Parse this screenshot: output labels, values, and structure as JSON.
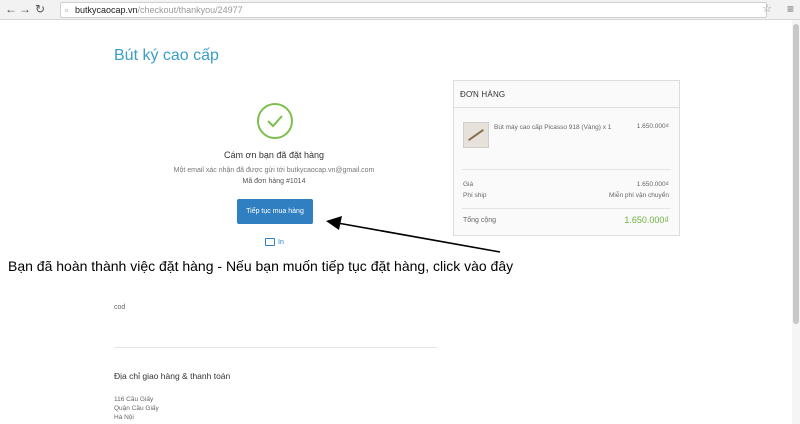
{
  "browser": {
    "url_host": "butkycaocap.vn",
    "url_path": "/checkout/thankyou/24977"
  },
  "page": {
    "shop_title": "Bút ký cao cấp",
    "thanks": "Cám ơn bạn đã đặt hàng",
    "email_notice": "Một email xác nhận đã được gửi tới butkycaocap.vn@gmail.com",
    "order_number": "Mã đơn hàng #1014",
    "continue_button": "Tiếp tục mua hàng",
    "print_label": "In",
    "payment_method": "cod",
    "address_heading": "Địa chỉ giao hàng & thanh toán",
    "address_lines": [
      "116 Cầu Giấy",
      "Quận Cầu Giấy",
      "Hà Nội"
    ]
  },
  "summary": {
    "heading": "ĐƠN HÀNG",
    "product_name": "Bút máy cao cấp Picasso 918 (Vàng) x 1",
    "product_price": "1.650.000₫",
    "price_label": "Giá",
    "price_value": "1.650.000₫",
    "shipping_label": "Phí ship",
    "shipping_value": "Miễn phí vận chuyển",
    "total_label": "Tổng cộng",
    "total_value": "1.650.000₫"
  },
  "annotation": {
    "text": "Bạn đã hoàn thành việc đặt hàng - Nếu bạn muốn tiếp tục đặt hàng, click vào đây"
  },
  "colors": {
    "accent": "#3a9ec8",
    "button": "#2f7fc1",
    "success": "#7cc04b",
    "total": "#6cb33f"
  }
}
